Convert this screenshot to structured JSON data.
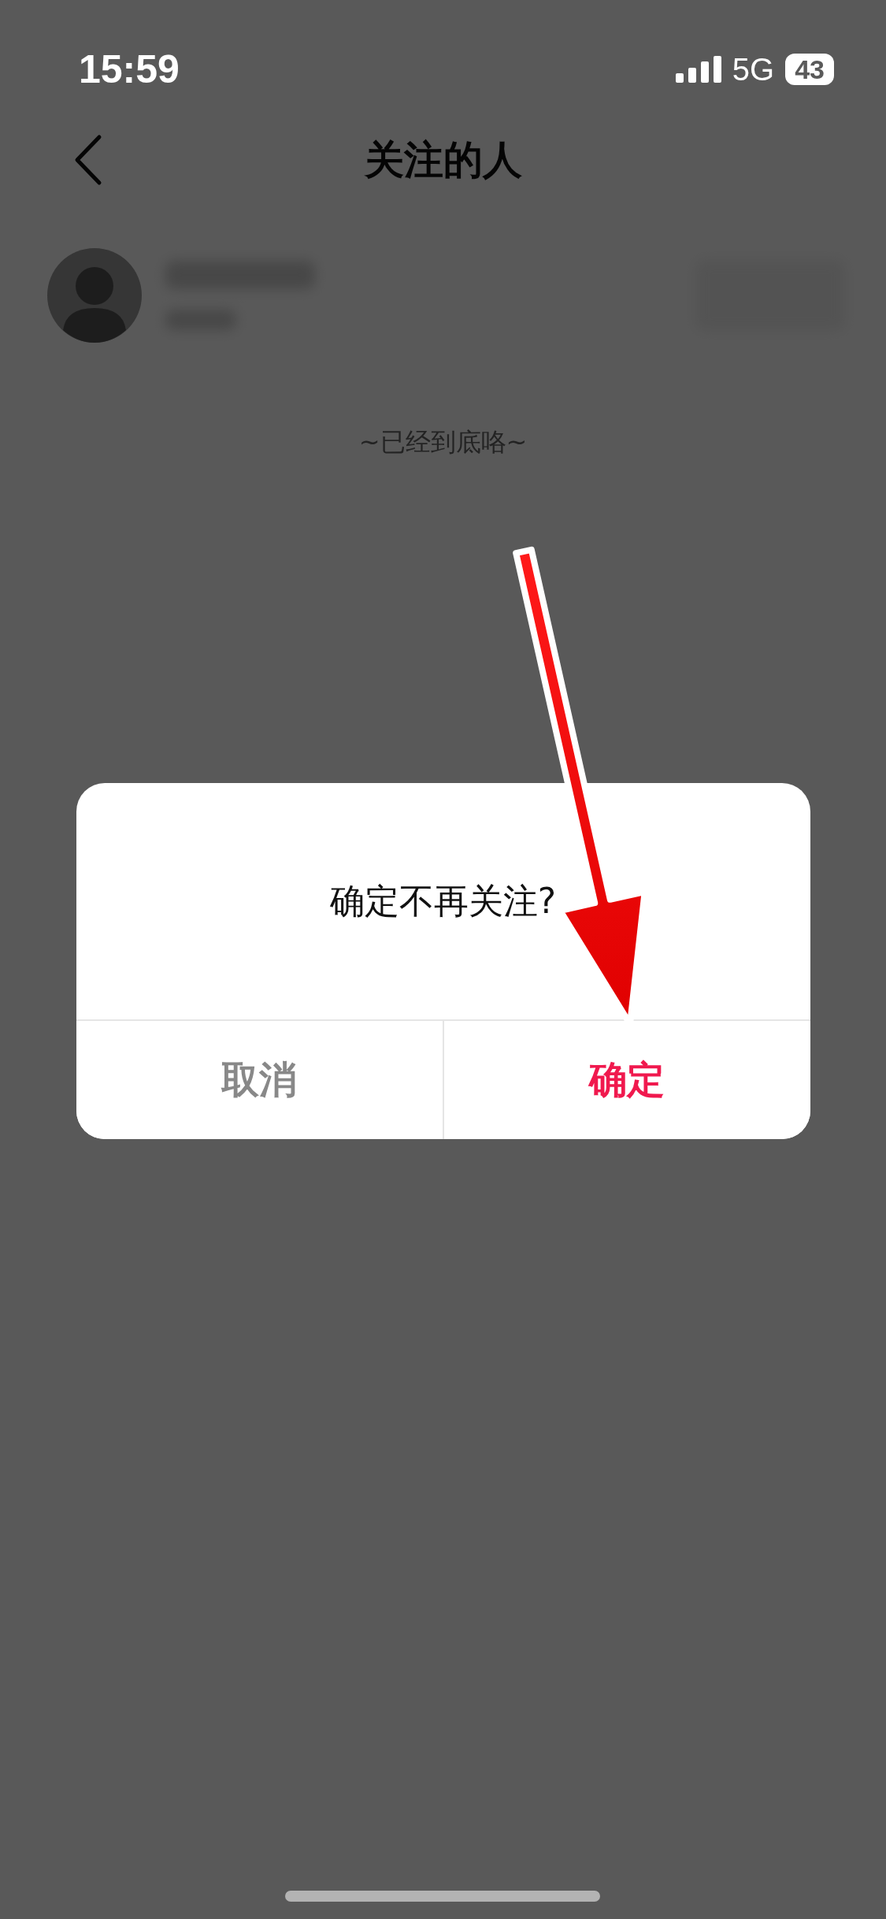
{
  "status_bar": {
    "time": "15:59",
    "network": "5G",
    "battery": "43"
  },
  "nav": {
    "title": "关注的人"
  },
  "list": {
    "end_text": "~已经到底咯~"
  },
  "dialog": {
    "message": "确定不再关注?",
    "buttons": [
      {
        "label": "取消",
        "kind": "cancel"
      },
      {
        "label": "确定",
        "kind": "confirm"
      }
    ]
  }
}
